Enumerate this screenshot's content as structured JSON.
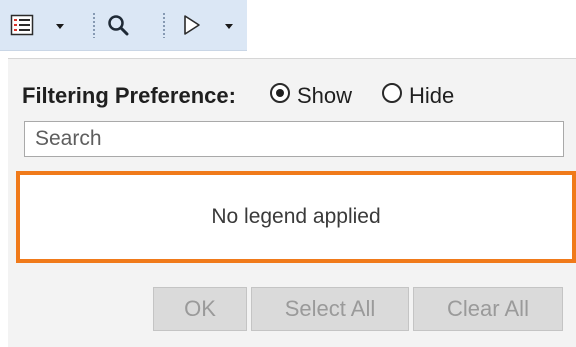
{
  "toolbar": {
    "icons": [
      "list-view-icon",
      "chevron-down-icon",
      "search-icon",
      "play-icon",
      "chevron-down-icon"
    ]
  },
  "filter": {
    "label": "Filtering Preference:",
    "options": [
      {
        "label": "Show",
        "checked": true
      },
      {
        "label": "Hide",
        "checked": false
      }
    ]
  },
  "search": {
    "placeholder": "Search",
    "value": ""
  },
  "legend": {
    "empty_text": "No legend applied",
    "highlight_color": "#f07a1a"
  },
  "buttons": {
    "ok": "OK",
    "select_all": "Select All",
    "clear_all": "Clear All"
  }
}
